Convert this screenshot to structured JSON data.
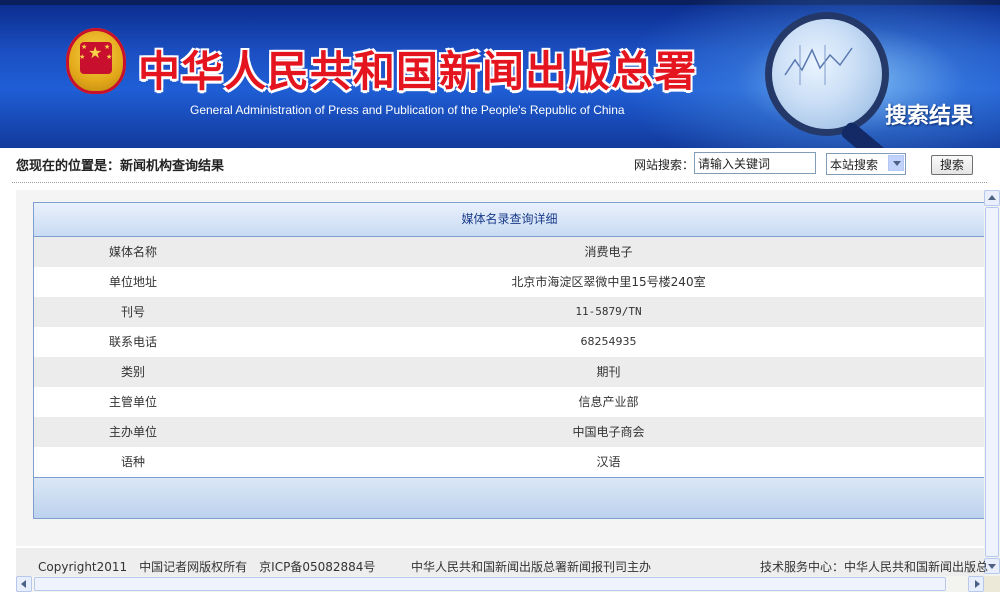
{
  "header": {
    "site_title": "中华人民共和国新闻出版总署",
    "site_subtitle": "General Administration of Press and Publication of the People's Republic of China",
    "page_tag": "搜索结果"
  },
  "location_bar": {
    "location_text": "您现在的位置是：新闻机构查询结果",
    "site_search_label": "网站搜索：",
    "search_value": "请输入关键词",
    "scope_selected": "本站搜索",
    "search_button": "搜索"
  },
  "detail": {
    "title": "媒体名录查询详细",
    "rows": [
      {
        "label": "媒体名称",
        "value": "消费电子"
      },
      {
        "label": "单位地址",
        "value": "北京市海淀区翠微中里15号楼240室"
      },
      {
        "label": "刊号",
        "value": "11-5879/TN"
      },
      {
        "label": "联系电话",
        "value": "68254935"
      },
      {
        "label": "类别",
        "value": "期刊"
      },
      {
        "label": "主管单位",
        "value": "信息产业部"
      },
      {
        "label": "主办单位",
        "value": "中国电子商会"
      },
      {
        "label": "语种",
        "value": "汉语"
      }
    ]
  },
  "footer": {
    "copyright": "Copyright2011　中国记者网版权所有　京ICP备05082884号",
    "sponsor": "中华人民共和国新闻出版总署新闻报刊司主办",
    "tech_support": "技术服务中心：中华人民共和国新闻出版总"
  },
  "colors": {
    "banner_blue": "#1f5ed6",
    "title_red": "#e4151f",
    "table_border": "#7f9fcf"
  }
}
